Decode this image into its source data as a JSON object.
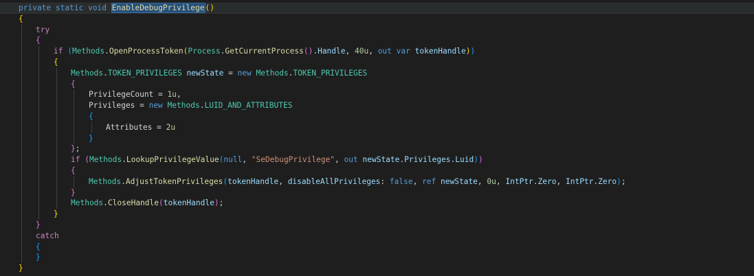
{
  "editor": {
    "language": "csharp",
    "colors": {
      "background": "#1e1e1e",
      "keyword": "#569cd6",
      "control": "#c586c0",
      "type": "#4ec9b0",
      "method": "#dcdcaa",
      "variable": "#9cdcfe",
      "number": "#b5cea8",
      "string": "#ce9178",
      "bracket_level1": "#ffd700",
      "bracket_level2": "#da70d6",
      "bracket_level3": "#179fff"
    },
    "selected_identifier": "EnableDebugPrivilege",
    "lines": [
      "private static void EnableDebugPrivilege()",
      "{",
      "    try",
      "    {",
      "        if (Methods.OpenProcessToken(Process.GetCurrentProcess().Handle, 40u, out var tokenHandle))",
      "        {",
      "            Methods.TOKEN_PRIVILEGES newState = new Methods.TOKEN_PRIVILEGES",
      "            {",
      "                PrivilegeCount = 1u,",
      "                Privileges = new Methods.LUID_AND_ATTRIBUTES",
      "                {",
      "                    Attributes = 2u",
      "                }",
      "            };",
      "            if (Methods.LookupPrivilegeValue(null, \"SeDebugPrivilege\", out newState.Privileges.Luid))",
      "            {",
      "                Methods.AdjustTokenPrivileges(tokenHandle, disableAllPrivileges: false, ref newState, 0u, IntPtr.Zero, IntPtr.Zero);",
      "            }",
      "            Methods.CloseHandle(tokenHandle);",
      "        }",
      "    }",
      "    catch",
      "    {",
      "    }",
      "}"
    ],
    "tokens": {
      "private": "private",
      "static": "static",
      "void": "void",
      "enable_debug_privilege": "EnableDebugPrivilege",
      "try": "try",
      "if": "if",
      "catch": "catch",
      "methods": "Methods",
      "open_process_token": "OpenProcessToken",
      "process": "Process",
      "get_current_process": "GetCurrentProcess",
      "handle": "Handle",
      "num_40u": "40u",
      "out": "out",
      "var": "var",
      "token_handle": "tokenHandle",
      "token_privileges": "TOKEN_PRIVILEGES",
      "new_state": "newState",
      "new": "new",
      "privilege_count": "PrivilegeCount",
      "num_1u": "1u",
      "privileges": "Privileges",
      "luid_and_attributes": "LUID_AND_ATTRIBUTES",
      "attributes": "Attributes",
      "num_2u": "2u",
      "lookup_privilege_value": "LookupPrivilegeValue",
      "null": "null",
      "se_debug_privilege_str": "\"SeDebugPrivilege\"",
      "luid": "Luid",
      "adjust_token_privileges": "AdjustTokenPrivileges",
      "disable_all_privileges": "disableAllPrivileges",
      "false": "false",
      "ref": "ref",
      "num_0u": "0u",
      "intptr": "IntPtr",
      "zero": "Zero",
      "close_handle": "CloseHandle"
    }
  }
}
